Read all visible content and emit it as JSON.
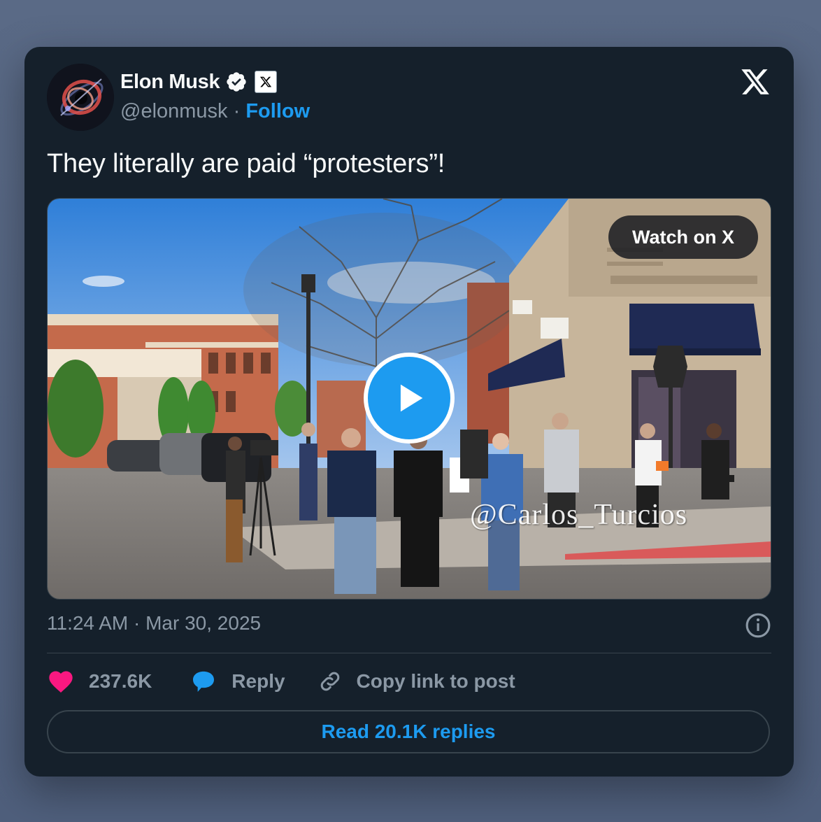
{
  "author": {
    "name": "Elon Musk",
    "handle": "@elonmusk",
    "separator": "·",
    "follow_label": "Follow",
    "verified_icon": "verified-badge-icon",
    "affiliation_icon": "x-affiliate-badge-icon"
  },
  "post": {
    "text": "They literally are paid “protesters”!",
    "timestamp": "11:24 AM · Mar 30, 2025"
  },
  "media": {
    "watch_label": "Watch on X",
    "watermark": "@Carlos_Turcios",
    "play_icon": "play-icon"
  },
  "actions": {
    "likes": "237.6K",
    "reply_label": "Reply",
    "copy_label": "Copy link to post",
    "read_replies_label": "Read 20.1K replies"
  },
  "colors": {
    "card_bg": "#15202b",
    "accent": "#1d9bf0",
    "like": "#f91880",
    "muted": "#8b98a5"
  }
}
